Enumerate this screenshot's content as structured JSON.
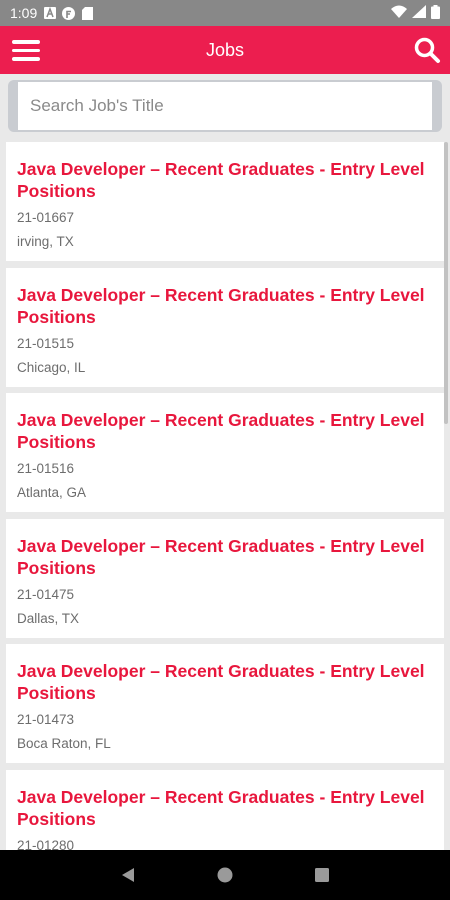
{
  "status_bar": {
    "time": "1:09",
    "icons_left": [
      "a-icon",
      "f-icon",
      "sd-card-icon"
    ],
    "icons_right": [
      "wifi-icon",
      "signal-icon",
      "battery-icon"
    ]
  },
  "app_bar": {
    "title": "Jobs",
    "menu_icon": "hamburger-menu-icon",
    "search_icon": "search-icon",
    "color": "#ec1e4f"
  },
  "search": {
    "placeholder": "Search Job's Title",
    "value": ""
  },
  "jobs": [
    {
      "title": "Java Developer – Recent Graduates - Entry Level Positions",
      "id": "21-01667",
      "location": "irving, TX"
    },
    {
      "title": "Java Developer – Recent Graduates - Entry Level Positions",
      "id": "21-01515",
      "location": "Chicago, IL"
    },
    {
      "title": "Java Developer – Recent Graduates - Entry Level Positions",
      "id": "21-01516",
      "location": "Atlanta, GA"
    },
    {
      "title": "Java Developer – Recent Graduates - Entry Level Positions",
      "id": "21-01475",
      "location": "Dallas, TX"
    },
    {
      "title": "Java Developer – Recent Graduates - Entry Level Positions",
      "id": "21-01473",
      "location": "Boca Raton, FL"
    },
    {
      "title": "Java Developer – Recent Graduates - Entry Level Positions",
      "id": "21-01280",
      "location": ""
    }
  ],
  "nav_bar": {
    "buttons": [
      "back-icon",
      "home-icon",
      "recents-icon"
    ]
  }
}
